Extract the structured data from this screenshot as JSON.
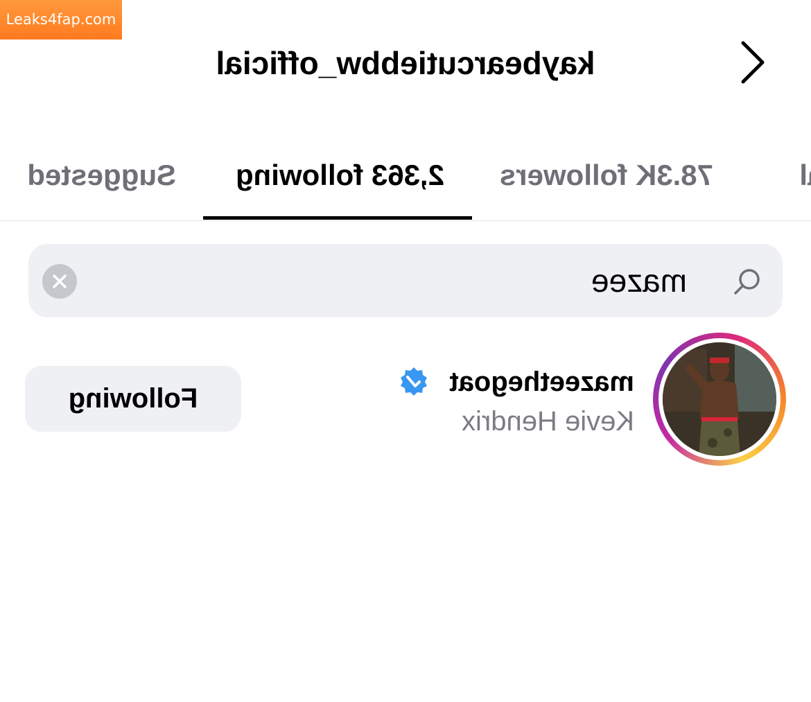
{
  "watermark": {
    "text": "Leaks4fap.com"
  },
  "header": {
    "title": "kaybearcutiebbw_official",
    "back_icon": "chevron-left-icon"
  },
  "tabs": [
    {
      "label": "ual",
      "active": false
    },
    {
      "label": "78.3K followers",
      "active": false
    },
    {
      "label": "2,363 following",
      "active": true
    },
    {
      "label": "Suggested",
      "active": false
    }
  ],
  "search": {
    "value": "mazee",
    "icon": "search-icon",
    "clear_icon": "clear-icon"
  },
  "results": [
    {
      "username": "mazeethegoat",
      "verified": true,
      "full_name": "Kevie Hendrix",
      "button_label": "Following",
      "has_story_ring": true
    }
  ],
  "colors": {
    "tab_inactive": "#6f6f78",
    "search_bg": "#eff0f4",
    "verified_blue": "#3897f0",
    "watermark_orange": "#ff8a2b"
  }
}
